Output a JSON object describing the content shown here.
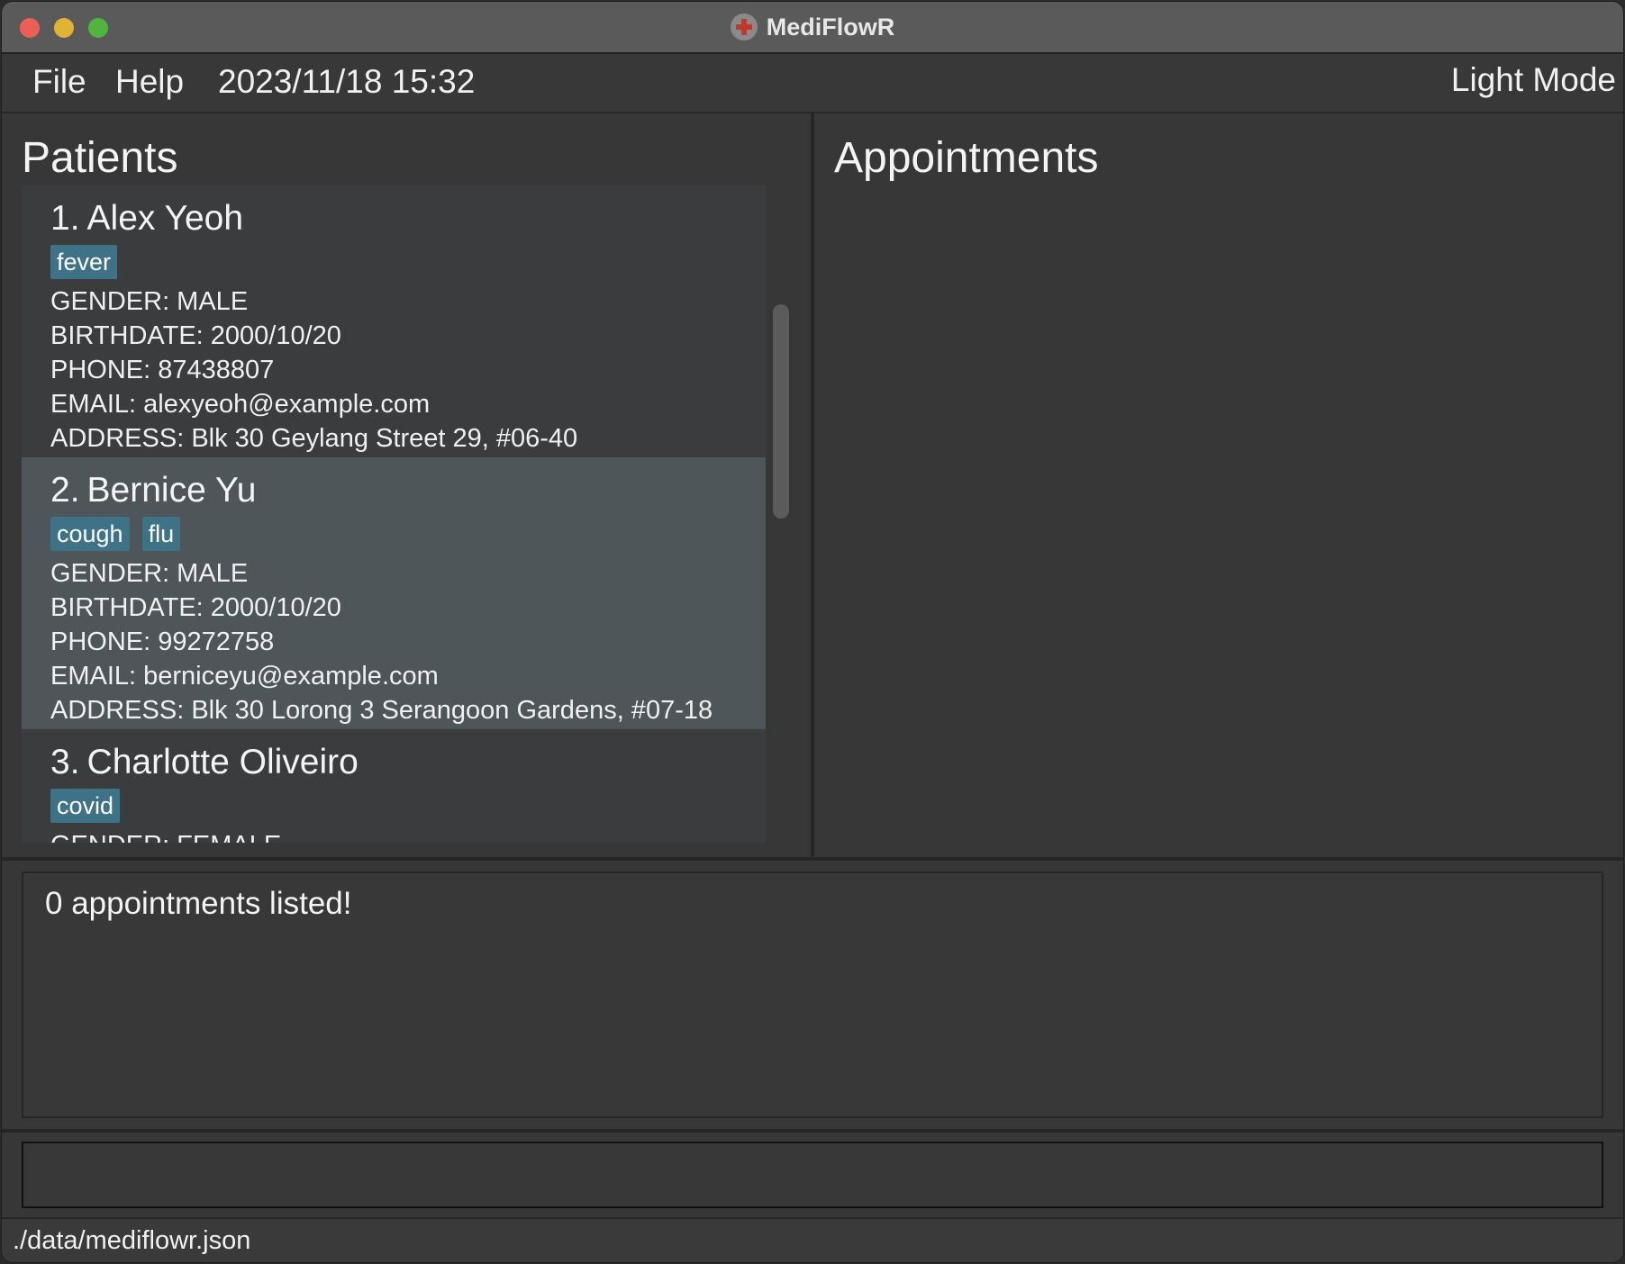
{
  "window": {
    "title": "MediFlowR"
  },
  "menu": {
    "file": "File",
    "help": "Help",
    "datetime": "2023/11/18 15:32",
    "theme_toggle": "Light Mode"
  },
  "patients": {
    "title": "Patients",
    "items": [
      {
        "index": "1.",
        "name": "Alex Yeoh",
        "tags": [
          "fever"
        ],
        "gender": "GENDER: MALE",
        "birthdate": "BIRTHDATE: 2000/10/20",
        "phone": "PHONE: 87438807",
        "email": "EMAIL: alexyeoh@example.com",
        "address": "ADDRESS: Blk 30 Geylang Street 29, #06-40"
      },
      {
        "index": "2.",
        "name": "Bernice Yu",
        "tags": [
          "cough",
          "flu"
        ],
        "gender": "GENDER: MALE",
        "birthdate": "BIRTHDATE: 2000/10/20",
        "phone": "PHONE: 99272758",
        "email": "EMAIL: berniceyu@example.com",
        "address": "ADDRESS: Blk 30 Lorong 3 Serangoon Gardens, #07-18",
        "selected": true
      },
      {
        "index": "3.",
        "name": "Charlotte Oliveiro",
        "tags": [
          "covid"
        ],
        "gender": "GENDER: FEMALE",
        "birthdate": "",
        "phone": "",
        "email": "",
        "address": ""
      }
    ]
  },
  "appointments": {
    "title": "Appointments",
    "items": []
  },
  "result": {
    "message": "0 appointments listed!"
  },
  "command": {
    "value": "",
    "placeholder": ""
  },
  "status": {
    "file_path": "./data/mediflowr.json"
  },
  "colors": {
    "tag_bg": "#3d7287",
    "selected_row": "#4f5659",
    "panel_bg": "#373737",
    "close": "#ec5f57",
    "minimize": "#e0b334",
    "maximize": "#50b43d"
  }
}
